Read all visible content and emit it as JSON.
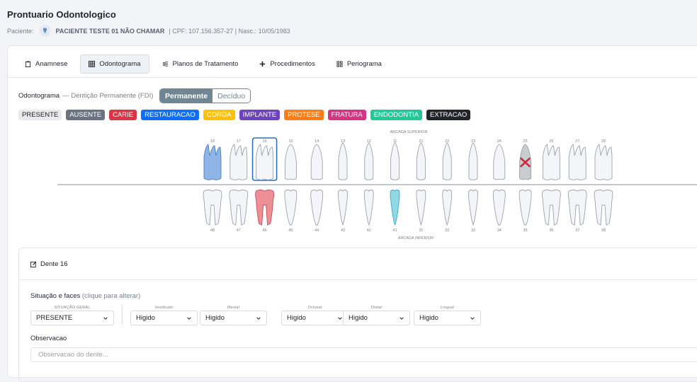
{
  "header": {
    "title": "Prontuario Odontologico",
    "patient_label": "Paciente:",
    "patient_name": "PACIENTE TESTE 01 NÃO CHAMAR",
    "patient_info": "| CPF: 107.156.357-27 | Nasc.: 10/05/1983"
  },
  "tabs": [
    {
      "label": "Anamnese",
      "icon": "clipboard-icon"
    },
    {
      "label": "Odontograma",
      "icon": "grid-icon",
      "active": true
    },
    {
      "label": "Planos de Tratamento",
      "icon": "lines-icon"
    },
    {
      "label": "Procedimentos",
      "icon": "plus-icon"
    },
    {
      "label": "Periograma",
      "icon": "dots-grid-icon"
    }
  ],
  "odontograma": {
    "title": "Odontograma",
    "subtitle": "— Dentição Permanente (FDI)",
    "toggle": {
      "on": "Permanente",
      "off": "Decíduo"
    },
    "legend": [
      {
        "label": "PRESENTE",
        "bg": "#e9ebef",
        "fg": "#222222"
      },
      {
        "label": "AUSENTE",
        "bg": "#6b7280",
        "fg": "#ffffff"
      },
      {
        "label": "CARIE",
        "bg": "#dc3545",
        "fg": "#ffffff"
      },
      {
        "label": "RESTAURACAO",
        "bg": "#0d6efd",
        "fg": "#ffffff"
      },
      {
        "label": "COROA",
        "bg": "#ffc107",
        "fg": "#ffffff"
      },
      {
        "label": "IMPLANTE",
        "bg": "#6f42c1",
        "fg": "#ffffff"
      },
      {
        "label": "PROTESE",
        "bg": "#fd7e14",
        "fg": "#ffffff"
      },
      {
        "label": "FRATURA",
        "bg": "#d63384",
        "fg": "#ffffff"
      },
      {
        "label": "ENDODONTIA",
        "bg": "#20c997",
        "fg": "#ffffff"
      },
      {
        "label": "EXTRACAO",
        "bg": "#212529",
        "fg": "#ffffff"
      }
    ],
    "upper_label": "ARCADA SUPERIOR",
    "lower_label": "ARCADA INFERIOR",
    "upper_teeth": [
      {
        "n": "18",
        "status": "restauracao"
      },
      {
        "n": "17",
        "status": "presente"
      },
      {
        "n": "16",
        "status": "presente",
        "selected": true
      },
      {
        "n": "15",
        "status": "presente"
      },
      {
        "n": "14",
        "status": "presente"
      },
      {
        "n": "13",
        "status": "presente"
      },
      {
        "n": "12",
        "status": "presente"
      },
      {
        "n": "11",
        "status": "presente"
      },
      {
        "n": "21",
        "status": "presente"
      },
      {
        "n": "22",
        "status": "presente"
      },
      {
        "n": "23",
        "status": "presente"
      },
      {
        "n": "24",
        "status": "presente"
      },
      {
        "n": "25",
        "status": "extracao"
      },
      {
        "n": "26",
        "status": "presente"
      },
      {
        "n": "27",
        "status": "presente"
      },
      {
        "n": "28",
        "status": "presente"
      }
    ],
    "lower_teeth": [
      {
        "n": "48",
        "status": "presente"
      },
      {
        "n": "47",
        "status": "presente"
      },
      {
        "n": "46",
        "status": "carie"
      },
      {
        "n": "45",
        "status": "presente"
      },
      {
        "n": "44",
        "status": "presente"
      },
      {
        "n": "43",
        "status": "presente"
      },
      {
        "n": "42",
        "status": "presente"
      },
      {
        "n": "41",
        "status": "endodontia"
      },
      {
        "n": "31",
        "status": "presente"
      },
      {
        "n": "32",
        "status": "presente"
      },
      {
        "n": "33",
        "status": "presente"
      },
      {
        "n": "34",
        "status": "presente"
      },
      {
        "n": "35",
        "status": "presente"
      },
      {
        "n": "36",
        "status": "presente"
      },
      {
        "n": "37",
        "status": "presente"
      },
      {
        "n": "38",
        "status": "presente"
      }
    ]
  },
  "detail": {
    "title": "Dente 16",
    "faces_label": "Situação e faces",
    "faces_hint": "(clique para alterar)",
    "general_label": "SITUAÇÃO GERAL",
    "general_value": "PRESENTE",
    "faces": [
      {
        "label": "Vestibular",
        "value": "Higido"
      },
      {
        "label": "Mesial",
        "value": "Higido"
      },
      {
        "label": "Oclusal",
        "value": "Higido"
      },
      {
        "label": "Distal",
        "value": "Higido"
      },
      {
        "label": "Lingual",
        "value": "Higido"
      }
    ],
    "obs_label": "Observacao",
    "obs_placeholder": "Observacao do dente..."
  }
}
